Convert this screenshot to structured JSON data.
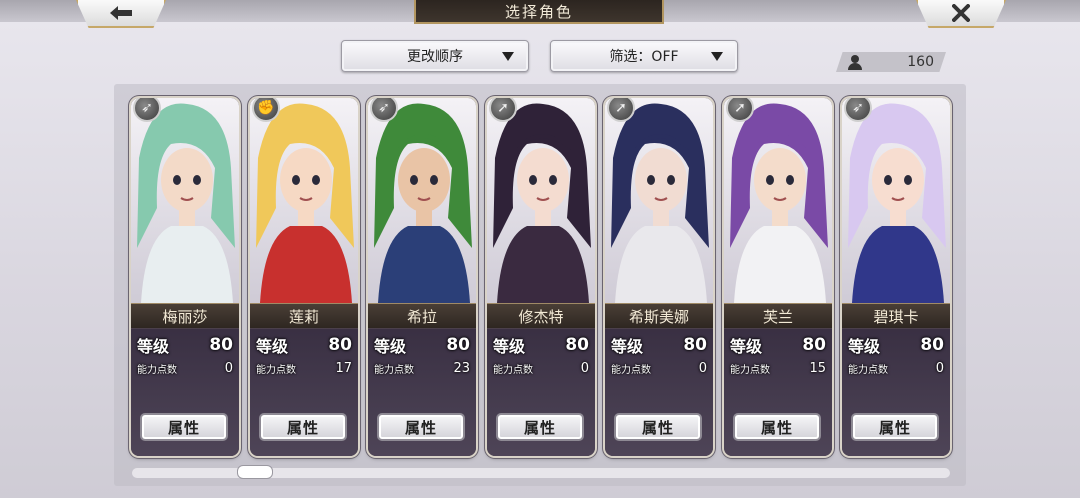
{
  "header": {
    "title": "选择角色",
    "back_icon": "back-arrow-icon",
    "close_icon": "close-x-icon"
  },
  "toolbar": {
    "order_label": "更改顺序",
    "filter_label": "筛选：OFF",
    "character_count": "160"
  },
  "characters": [
    {
      "name": "梅丽莎",
      "level_label": "等级",
      "level": "80",
      "ap_label": "能力点数",
      "ap": "0",
      "attr_label": "属性",
      "weapon": "bow-icon",
      "hair": "#86c9ae",
      "skin": "#f3dac8",
      "outfit": "#e8eef0"
    },
    {
      "name": "莲莉",
      "level_label": "等级",
      "level": "80",
      "ap_label": "能力点数",
      "ap": "17",
      "attr_label": "属性",
      "weapon": "gauntlet-icon",
      "hair": "#f0c85a",
      "skin": "#f6d9c4",
      "outfit": "#c8302e"
    },
    {
      "name": "希拉",
      "level_label": "等级",
      "level": "80",
      "ap_label": "能力点数",
      "ap": "23",
      "attr_label": "属性",
      "weapon": "bow-icon",
      "hair": "#3f8a3a",
      "skin": "#e9c4a6",
      "outfit": "#2b3f78"
    },
    {
      "name": "修杰特",
      "level_label": "等级",
      "level": "80",
      "ap_label": "能力点数",
      "ap": "0",
      "attr_label": "属性",
      "weapon": "spear-icon",
      "hair": "#2f2238",
      "skin": "#f4dcd0",
      "outfit": "#3a2a40"
    },
    {
      "name": "希斯美娜",
      "level_label": "等级",
      "level": "80",
      "ap_label": "能力点数",
      "ap": "0",
      "attr_label": "属性",
      "weapon": "spear-icon",
      "hair": "#2a2f5e",
      "skin": "#f1dcd2",
      "outfit": "#e9e8ec"
    },
    {
      "name": "芙兰",
      "level_label": "等级",
      "level": "80",
      "ap_label": "能力点数",
      "ap": "15",
      "attr_label": "属性",
      "weapon": "spear-icon",
      "hair": "#7a4aa6",
      "skin": "#f4dccb",
      "outfit": "#f2f2f4"
    },
    {
      "name": "碧琪卡",
      "level_label": "等级",
      "level": "80",
      "ap_label": "能力点数",
      "ap": "0",
      "attr_label": "属性",
      "weapon": "bow-icon",
      "hair": "#d8c8f0",
      "skin": "#f7ddd0",
      "outfit": "#30378a"
    }
  ]
}
